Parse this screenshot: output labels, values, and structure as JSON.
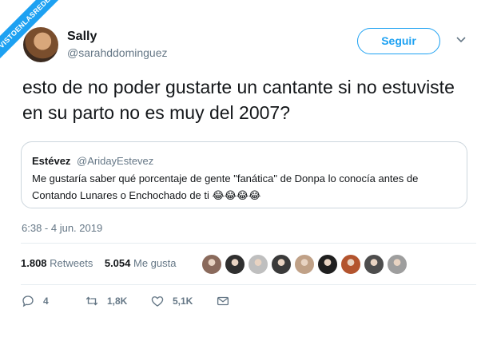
{
  "watermark": "VISTOENLASREDES",
  "author": {
    "name": "Sally",
    "handle": "@sarahddominguez"
  },
  "follow_label": "Seguir",
  "tweet_text": "esto de no poder gustarte un cantante si no estuviste en su parto no es muy del 2007?",
  "quote": {
    "name": "Estévez",
    "handle": "@AridayEstevez",
    "text": "Me gustaría saber qué porcentaje de gente \"fanática\" de Donpa lo conocía antes de Contando Lunares o Enchochado de ti 😂😂😂😂"
  },
  "timestamp": "6:38 - 4 jun. 2019",
  "stats": {
    "retweets_value": "1.808",
    "retweets_label": "Retweets",
    "likes_value": "5.054",
    "likes_label": "Me gusta"
  },
  "liker_avatars": [
    {
      "color": "#8a6a5c"
    },
    {
      "color": "#2f2f2f"
    },
    {
      "color": "#bfbfbf"
    },
    {
      "color": "#3a3a3a"
    },
    {
      "color": "#c0a187"
    },
    {
      "color": "#1f1f1f"
    },
    {
      "color": "#b3542e"
    },
    {
      "color": "#4d4d4d"
    },
    {
      "color": "#9e9e9e"
    }
  ],
  "actions": {
    "replies": "4",
    "retweets": "1,8K",
    "likes": "5,1K"
  },
  "icons": [
    "chevron-down-icon",
    "reply-icon",
    "retweet-icon",
    "heart-icon",
    "message-icon"
  ],
  "colors": {
    "accent": "#1da1f2",
    "muted": "#657786",
    "text": "#14171a",
    "border": "#ccd6dd"
  }
}
